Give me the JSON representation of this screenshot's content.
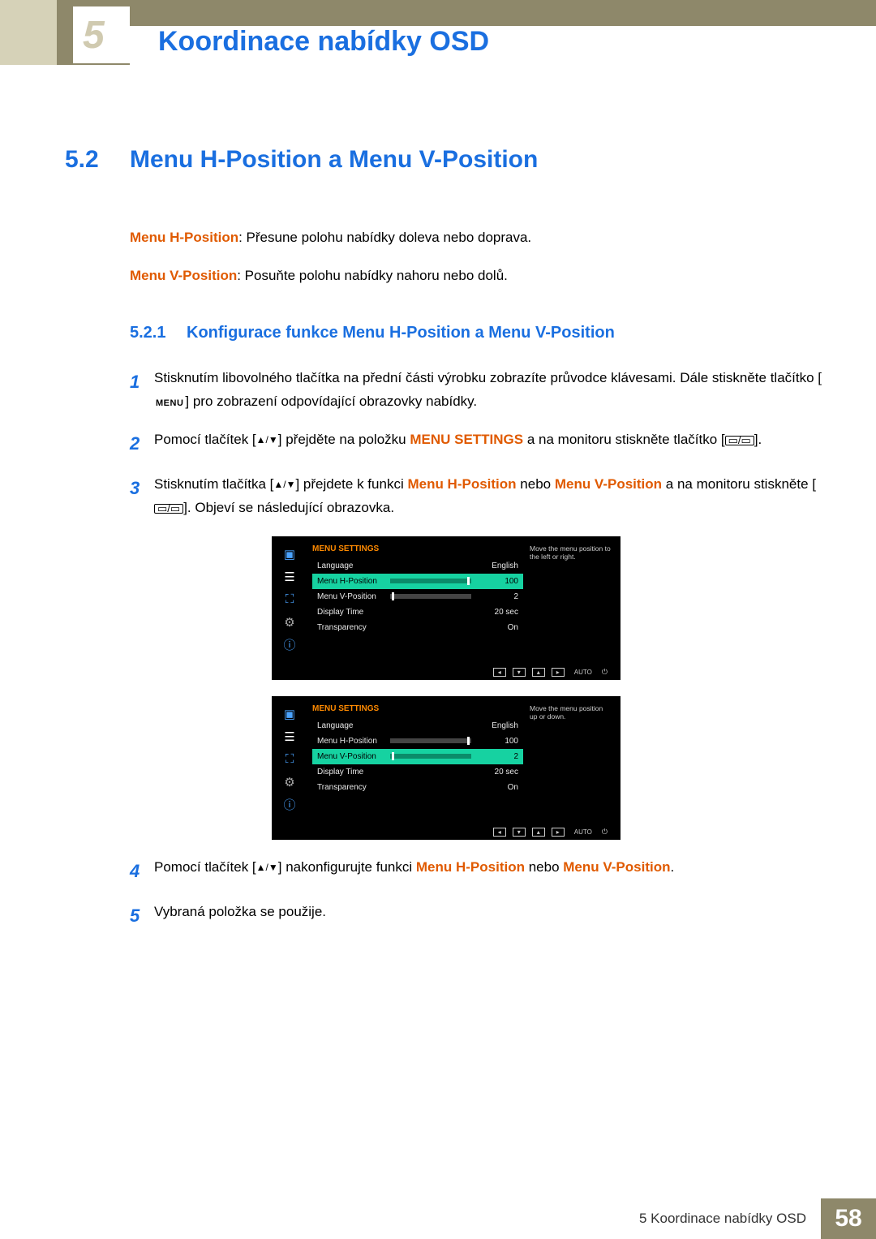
{
  "chapter": {
    "number": "5",
    "title": "Koordinace nabídky OSD"
  },
  "section": {
    "num": "5.2",
    "title": "Menu H-Position a Menu V-Position"
  },
  "intro": {
    "h_label": "Menu H-Position",
    "h_text": ": Přesune polohu nabídky doleva nebo doprava.",
    "v_label": "Menu V-Position",
    "v_text": ": Posuňte polohu nabídky nahoru nebo dolů."
  },
  "subsection": {
    "num": "5.2.1",
    "title": "Konfigurace funkce Menu H-Position a Menu V-Position"
  },
  "steps": {
    "s1a": "Stisknutím libovolného tlačítka na přední části výrobku zobrazíte průvodce klávesami. Dále stiskněte tlačítko [",
    "s1_menu": "MENU",
    "s1b": "] pro zobrazení odpovídající obrazovky nabídky.",
    "s2a": "Pomocí tlačítek [",
    "s2b": "] přejděte na položku ",
    "s2_hl": "MENU SETTINGS",
    "s2c": " a na monitoru stiskněte tlačítko [",
    "s2d": "].",
    "s3a": "Stisknutím tlačítka [",
    "s3b": "] přejdete k funkci ",
    "s3_hl1": "Menu H-Position",
    "s3_mid": " nebo ",
    "s3_hl2": "Menu V-Position",
    "s3c": " a na monitoru stiskněte [",
    "s3d": "]. Objeví se následující obrazovka.",
    "s4a": "Pomocí tlačítek [",
    "s4b": "] nakonfigurujte funkci ",
    "s4_hl1": "Menu H-Position",
    "s4_mid": " nebo ",
    "s4_hl2": "Menu V-Position",
    "s4c": ".",
    "s5": "Vybraná položka se použije."
  },
  "osd": {
    "title": "MENU SETTINGS",
    "rows": {
      "language": {
        "label": "Language",
        "value": "English"
      },
      "hpos": {
        "label": "Menu H-Position",
        "value": "100"
      },
      "vpos": {
        "label": "Menu V-Position",
        "value": "2"
      },
      "dtime": {
        "label": "Display Time",
        "value": "20 sec"
      },
      "trans": {
        "label": "Transparency",
        "value": "On"
      }
    },
    "help_h": "Move the menu position to the left or right.",
    "help_v": "Move the menu position up or down.",
    "auto": "AUTO"
  },
  "footer": {
    "text": "5 Koordinace nabídky OSD",
    "page": "58"
  }
}
